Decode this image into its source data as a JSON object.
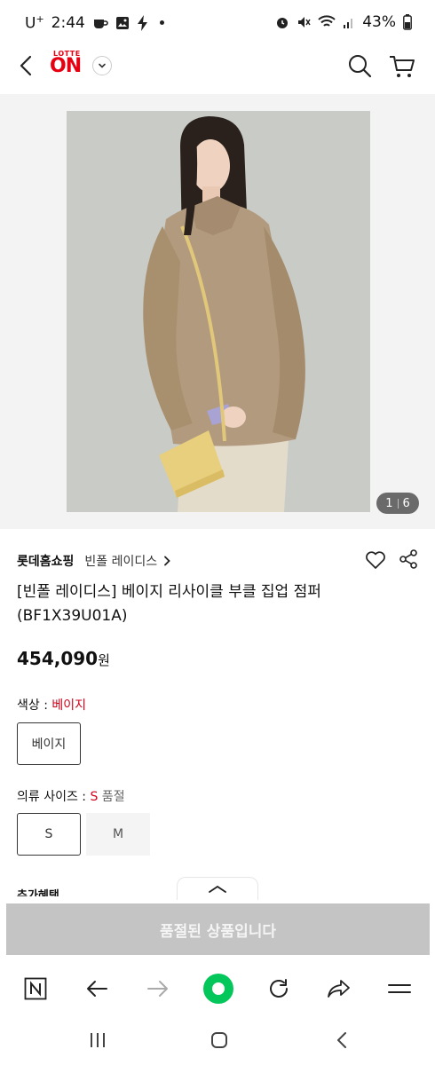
{
  "status_bar": {
    "carrier": "U",
    "carrier_sup": "+",
    "time": "2:44",
    "battery": "43%"
  },
  "header": {
    "logo_small": "LOTTE",
    "logo_big": "ON"
  },
  "gallery": {
    "current": "1",
    "total": "6"
  },
  "product": {
    "store": "롯데홈쇼핑",
    "brand": "빈폴 레이디스",
    "title_line1": "[빈폴 레이디스] 베이지 리사이클 부클 집업 점퍼",
    "title_line2": "(BF1X39U01A)",
    "price": "454,090",
    "price_unit": "원"
  },
  "color_option": {
    "label": "색상 : ",
    "value": "베이지",
    "options": [
      "베이지"
    ]
  },
  "size_option": {
    "label": "의류 사이즈 : ",
    "value": "S",
    "status": " 품절",
    "options": [
      "S",
      "M"
    ]
  },
  "benefit_label": "추가혜택",
  "soldout_button": "품절된 상품입니다",
  "colors": {
    "brand_red": "#e60012",
    "option_value_red": "#d0021b",
    "soldout_bg": "#c4c4c4",
    "naver_green": "#03c75a",
    "coat": "#b29a7f",
    "bag": "#e8cf7d"
  }
}
